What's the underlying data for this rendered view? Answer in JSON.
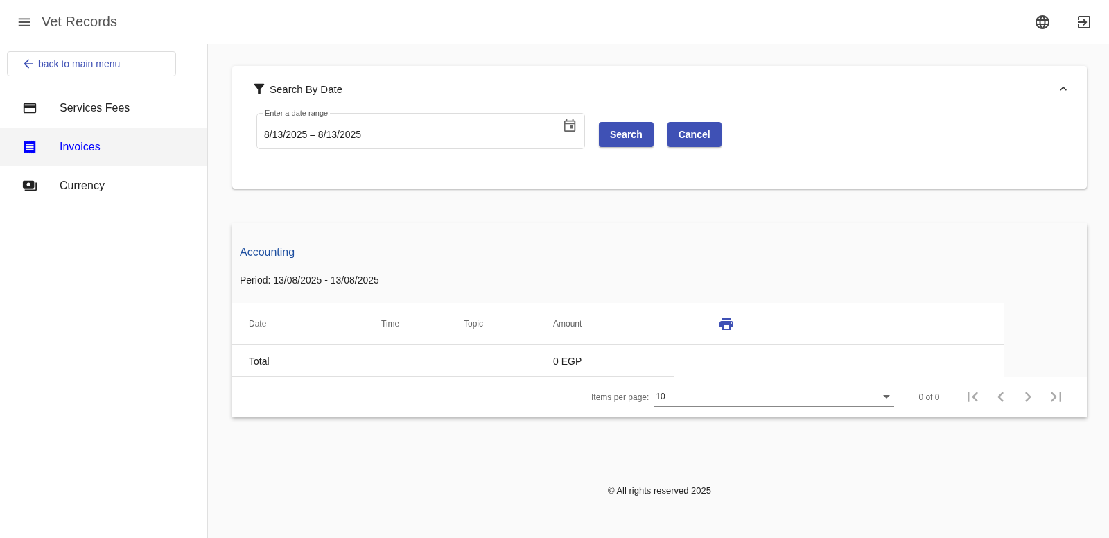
{
  "app_bar": {
    "title": "Vet Records"
  },
  "sidebar": {
    "back_link": "back to main menu",
    "items": [
      {
        "label": "Services Fees",
        "kind": "card",
        "selected": false
      },
      {
        "label": "Invoices",
        "kind": "receipt",
        "selected": true
      },
      {
        "label": "Currency",
        "kind": "money",
        "selected": false
      }
    ]
  },
  "search_panel": {
    "title": "Search By Date",
    "expanded": true,
    "date_field": {
      "label": "Enter a date range",
      "value": "8/13/2025 – 8/13/2025"
    },
    "buttons": [
      "Search",
      "Cancel"
    ]
  },
  "report": {
    "title": "Accounting",
    "period": "Period: 13/08/2025 - 13/08/2025",
    "table": {
      "columns": [
        "Date",
        "Time",
        "Topic",
        "Amount"
      ],
      "total_row": {
        "label": "Total",
        "amount": "0 EGP"
      }
    },
    "paginator": {
      "items_per_page_label": "Items per page:",
      "page_size": "10",
      "range": "0 of 0",
      "nav_buttons": [
        {
          "kind": "first",
          "disabled": true
        },
        {
          "kind": "previous",
          "disabled": true
        },
        {
          "kind": "next",
          "disabled": true
        },
        {
          "kind": "last",
          "disabled": true
        }
      ]
    }
  },
  "footer": {
    "text": "© All rights reserved 2025"
  }
}
